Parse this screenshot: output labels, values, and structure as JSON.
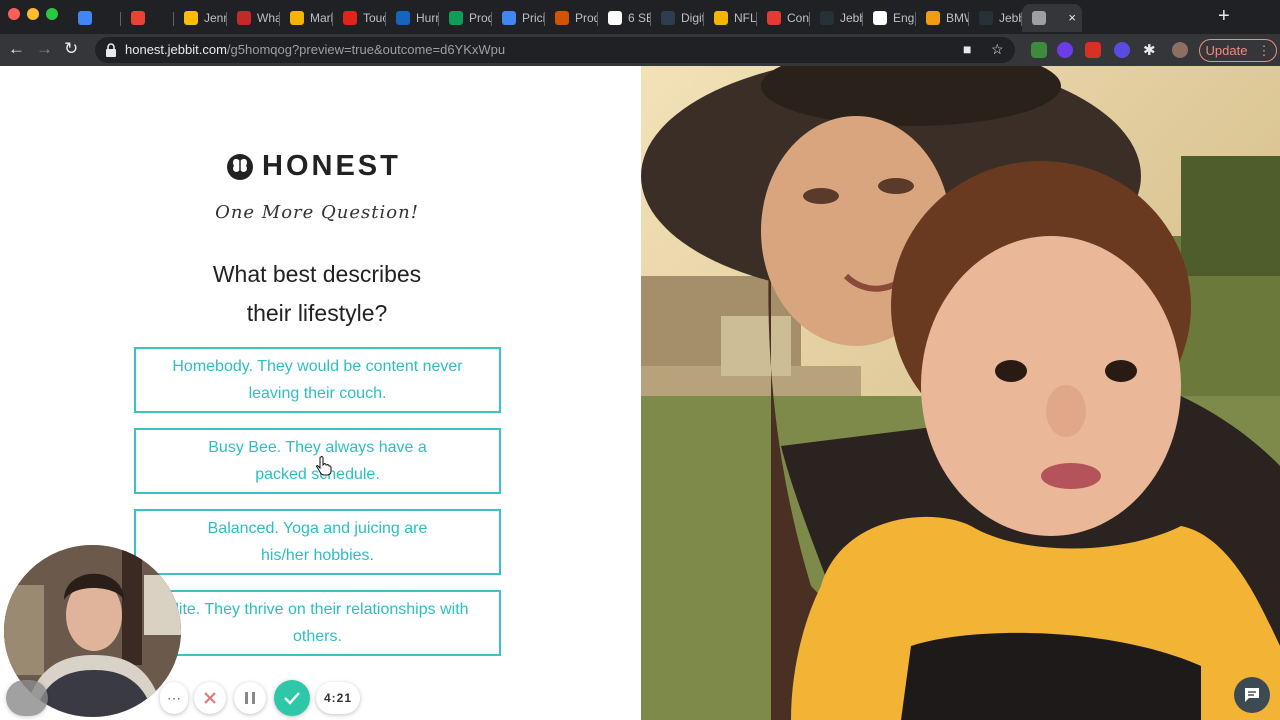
{
  "browser": {
    "tabs": [
      {
        "label": "",
        "favicon": "calendar-icon",
        "color": "#4285f4"
      },
      {
        "label": "",
        "favicon": "gmail-icon",
        "color": "#ea4335"
      },
      {
        "label": "Jenn",
        "favicon": "drive-icon",
        "color": "#fbbc04"
      },
      {
        "label": "What",
        "favicon": "hbr-icon",
        "color": "#c62828"
      },
      {
        "label": "Mark",
        "favicon": "slides-icon",
        "color": "#f4b400"
      },
      {
        "label": "Touc",
        "favicon": "m-icon",
        "color": "#e2231a"
      },
      {
        "label": "Hurr",
        "favicon": "site-icon",
        "color": "#1565c0"
      },
      {
        "label": "Prod",
        "favicon": "sheets-icon",
        "color": "#0f9d58"
      },
      {
        "label": "Pricir",
        "favicon": "docs-icon",
        "color": "#4285f4"
      },
      {
        "label": "Prod",
        "favicon": "p-icon",
        "color": "#d35400"
      },
      {
        "label": "6 SE",
        "favicon": "r-icon",
        "color": "#ffffff"
      },
      {
        "label": "Digit",
        "favicon": "circle-icon",
        "color": "#2c3e50"
      },
      {
        "label": "NFL",
        "favicon": "slides-icon",
        "color": "#f4b400"
      },
      {
        "label": "Cont",
        "favicon": "ring-icon",
        "color": "#e53935"
      },
      {
        "label": "Jebb",
        "favicon": "j-icon",
        "color": "#263238"
      },
      {
        "label": "Engi",
        "favicon": "dot-icon",
        "color": "#ffffff"
      },
      {
        "label": "BMW",
        "favicon": "a-icon",
        "color": "#f39c12"
      },
      {
        "label": "Jebb",
        "favicon": "j-icon",
        "color": "#263238"
      },
      {
        "label": "",
        "favicon": "record-icon",
        "color": "#9aa0a6",
        "active": true
      }
    ],
    "url_host": "honest.jebbit.com",
    "url_path": "/g5homqog?preview=true&outcome=d6YKxWpu",
    "update_label": "Update"
  },
  "page": {
    "brand": "HONEST",
    "tagline": "One More Question!",
    "question_line1": "What best describes",
    "question_line2": "their lifestyle?",
    "answers": [
      {
        "line1": "Homebody. They would be content never",
        "line2": "leaving their couch."
      },
      {
        "line1": "Busy Bee. They always have a",
        "line2": "packed schedule."
      },
      {
        "line1": "Balanced. Yoga and juicing are",
        "line2": "his/her hobbies."
      },
      {
        "line1": "alite. They thrive on their relationships with",
        "line2": "others."
      }
    ],
    "accent_color": "#39c3c7"
  },
  "recorder": {
    "timer": "4:21"
  }
}
